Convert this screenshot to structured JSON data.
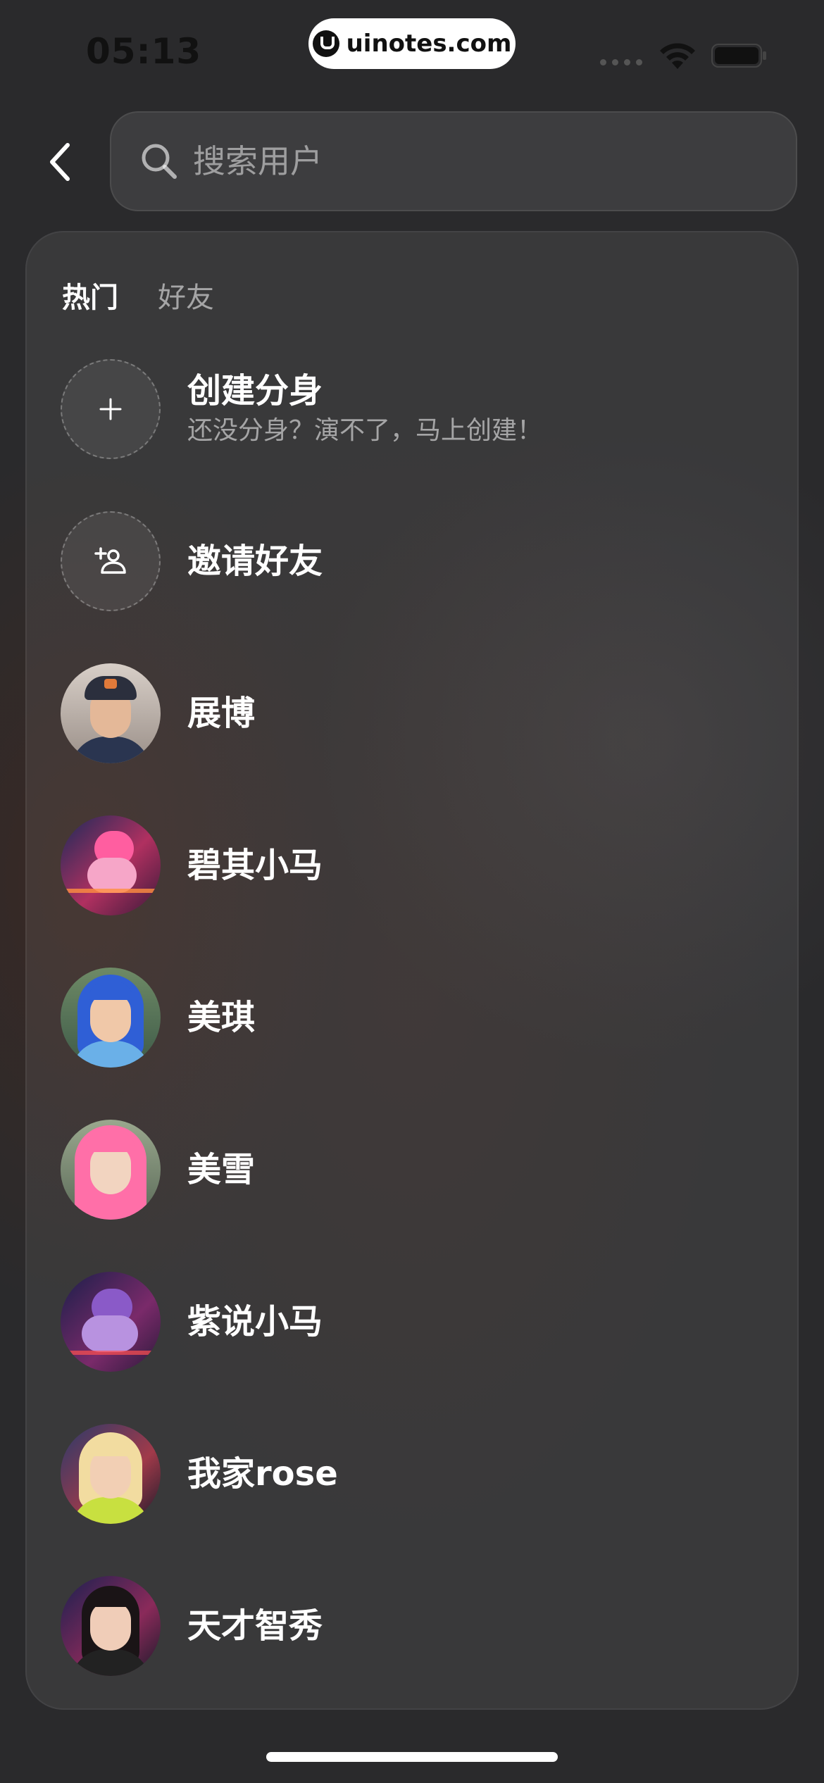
{
  "status_bar": {
    "time": "05:13",
    "watermark": "uinotes.com"
  },
  "search": {
    "placeholder": "搜索用户"
  },
  "tabs": [
    {
      "label": "热门",
      "active": true
    },
    {
      "label": "好友",
      "active": false
    }
  ],
  "actions": {
    "create_clone": {
      "title": "创建分身",
      "subtitle": "还没分身？演不了，马上创建！",
      "icon": "plus-icon"
    },
    "invite_friends": {
      "title": "邀请好友",
      "icon": "add-user-icon"
    }
  },
  "users": [
    {
      "name": "展博"
    },
    {
      "name": "碧其小马"
    },
    {
      "name": "美琪"
    },
    {
      "name": "美雪"
    },
    {
      "name": "紫说小马"
    },
    {
      "name": "我家rose"
    },
    {
      "name": "天才智秀"
    }
  ],
  "colors": {
    "background": "#2a2a2c",
    "panel": "#3a3735",
    "text_primary": "#ffffff",
    "text_secondary": "#8e8c8a"
  }
}
